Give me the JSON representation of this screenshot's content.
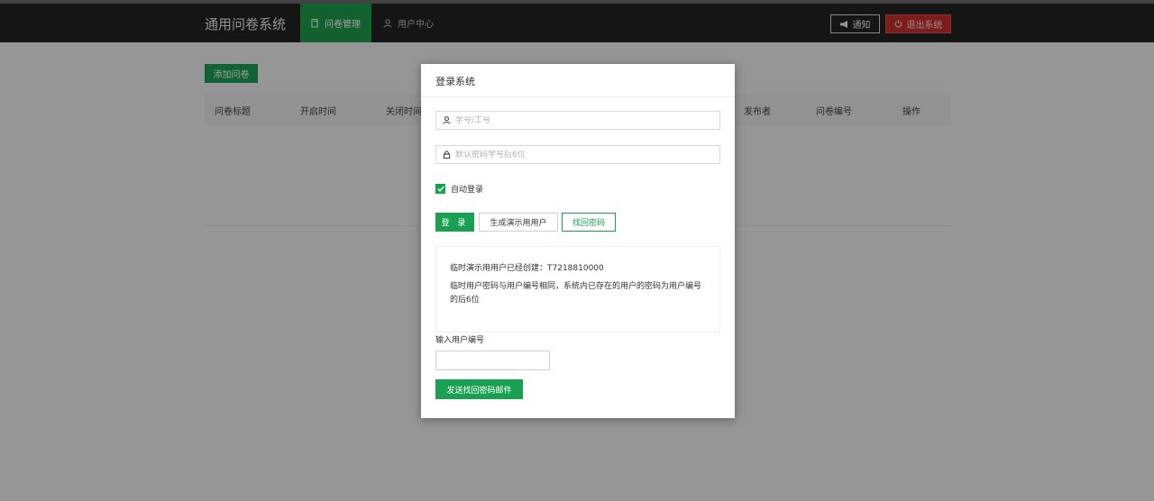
{
  "header": {
    "brand": "通用问卷系统",
    "nav": [
      {
        "label": "问卷管理",
        "icon": "document-icon",
        "active": true
      },
      {
        "label": "用户中心",
        "icon": "user-icon",
        "active": false
      }
    ],
    "notify_label": "通知",
    "logout_label": "退出系统"
  },
  "main": {
    "add_button": "添加问卷",
    "table_headers": [
      "问卷标题",
      "开启时间",
      "关闭时间",
      "发布者",
      "问卷编号",
      "操作"
    ]
  },
  "modal": {
    "title": "登录系统",
    "username_placeholder": "学号/工号",
    "password_placeholder": "默认密码学号后6位",
    "remember_label": "自动登录",
    "remember_checked": true,
    "login_button": "登 录",
    "demo_button": "生成演示用用户",
    "find_password_button": "找回密码",
    "notice_line1": "临时演示用用户已经创建：T7218810000",
    "notice_line2": "临时用户密码与用户编号相同，系统内已存在的用户的密码为用户编号的后6位",
    "id_input_label": "输入用户编号",
    "id_input_value": "",
    "send_button": "发送找回密码邮件"
  },
  "colors": {
    "header_bg": "#232323",
    "accent_green": "#1aa052",
    "logout_red": "#c9302c"
  }
}
